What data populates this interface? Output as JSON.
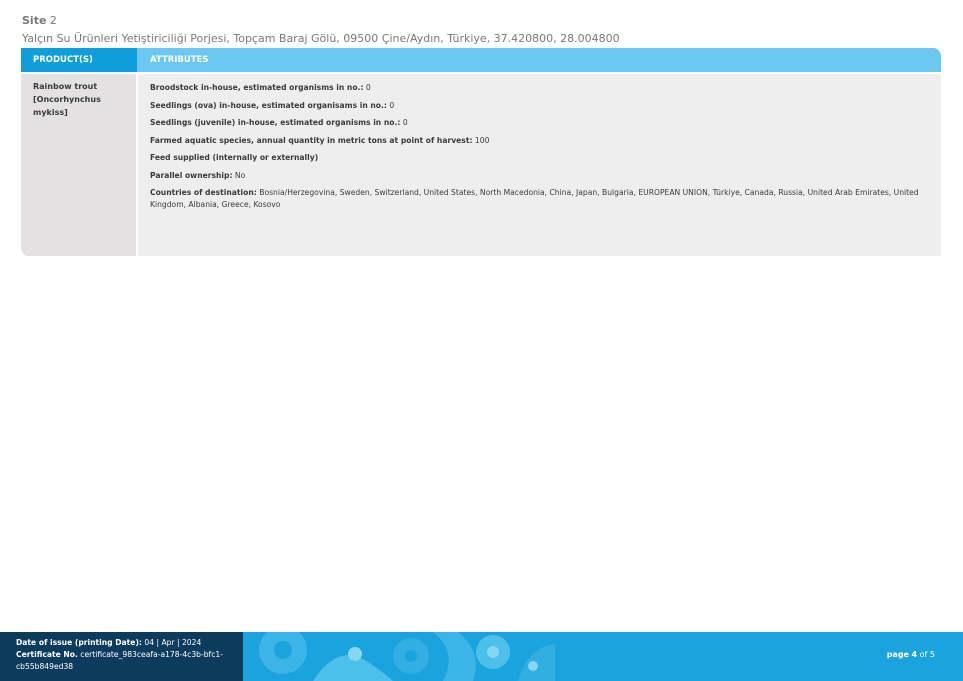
{
  "site": {
    "label": "Site",
    "number": "2",
    "address": "Yalçın Su Ürünleri Yetiştiriciliği Porjesi, Topçam Baraj Gölü, 09500 Çine/Aydın, Türkiye, 37.420800, 28.004800"
  },
  "table": {
    "headers": {
      "products": "PRODUCT(S)",
      "attributes": "ATTRIBUTES"
    },
    "product": "Rainbow trout [Oncorhynchus mykiss]",
    "attributes": [
      {
        "label": "Broodstock in-house, estimated organisms in no.:",
        "value": "0"
      },
      {
        "label": "Seedlings (ova) in-house, estimated organisams in no.:",
        "value": "0"
      },
      {
        "label": "Seedlings (juvenile) in-house, estimated organisms in no.:",
        "value": "0"
      },
      {
        "label": "Farmed aquatic species, annual quantity in metric tons at point of harvest:",
        "value": "100"
      },
      {
        "label": "Feed supplied (internally or externally)",
        "value": ""
      },
      {
        "label": "Parallel ownership:",
        "value": "No"
      },
      {
        "label": "Countries of destination:",
        "value": "Bosnia/Herzegovina, Sweden, Switzerland, United States, North Macedonia, China, Japan, Bulgaria, EUROPEAN UNION, Türkiye, Canada, Russia, United Arab Emirates, United Kingdom, Albania, Greece, Kosovo"
      }
    ]
  },
  "footer": {
    "issue_label": "Date of issue (printing Date):",
    "issue_value": "04 | Apr | 2024",
    "cert_label": "Certificate No.",
    "cert_value": "certificate_983ceafa-a178-4c3b-bfc1-cb55b849ed38",
    "page_label": "page",
    "page_current": "4",
    "page_of": "of",
    "page_total": "5"
  },
  "colors": {
    "header_dark": "#0e9fdb",
    "header_light": "#6cc8f0",
    "footer_dark": "#0d3b5e",
    "footer_blue": "#1aa3dd"
  }
}
